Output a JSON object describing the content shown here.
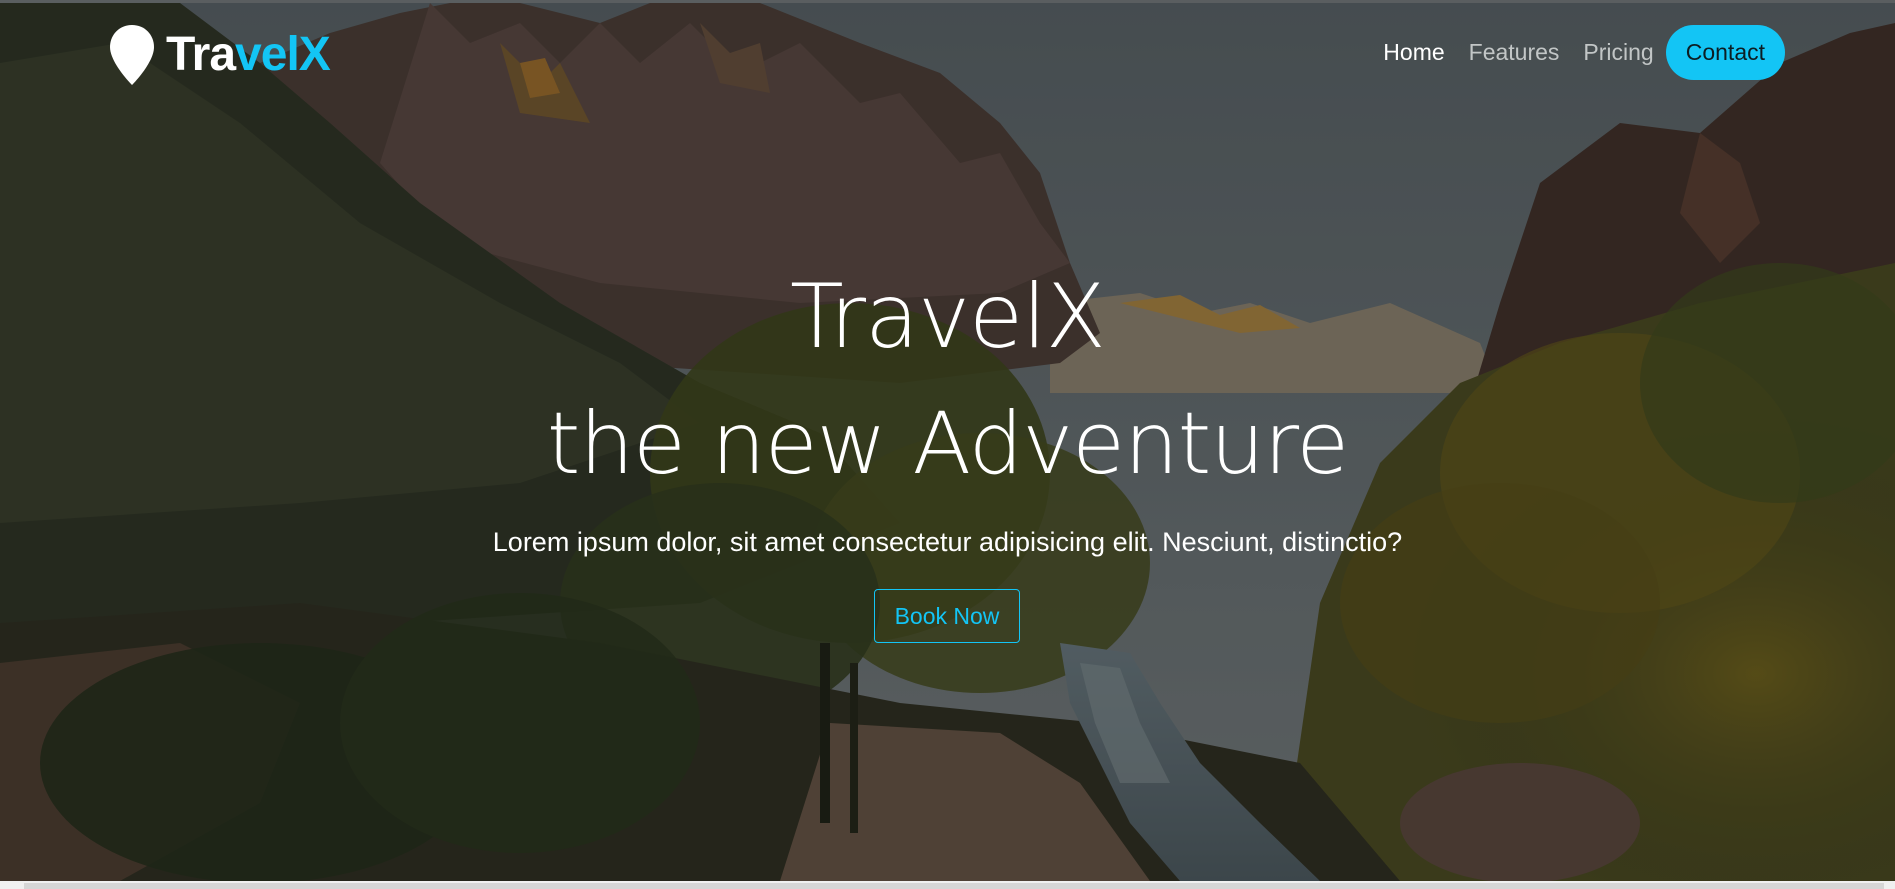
{
  "brand": {
    "part_white": "Tra",
    "part_blue": "velX",
    "icon": "map-pin-icon"
  },
  "nav": {
    "items": [
      {
        "label": "Home",
        "active": true
      },
      {
        "label": "Features",
        "active": false
      },
      {
        "label": "Pricing",
        "active": false
      }
    ],
    "contact_label": "Contact"
  },
  "hero": {
    "title_line_1": "TravelX",
    "title_line_2": "the new Adventure",
    "lead": "Lorem ipsum dolor, sit amet consectetur adipisicing elit. Nesciunt, distinctio?",
    "cta_label": "Book Now",
    "background": "canyon-landscape-image"
  },
  "colors": {
    "accent": "#13c5f5",
    "text": "#ffffff",
    "nav_muted": "#c2c6c6"
  }
}
